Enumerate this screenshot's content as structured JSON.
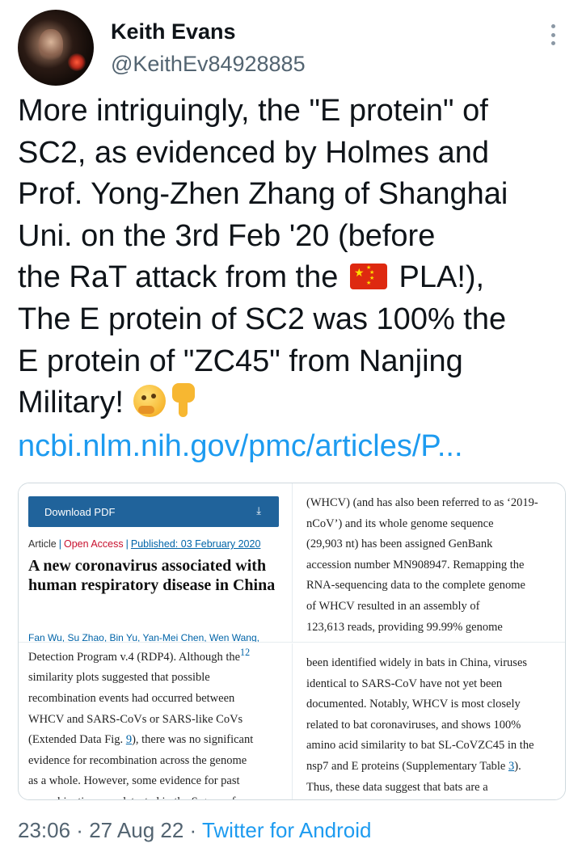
{
  "author": {
    "name": "Keith Evans",
    "handle": "@KeithEv84928885"
  },
  "tweet": {
    "lines": [
      "More intriguingly, the \"E protein\" of",
      "SC2, as evidenced by Holmes and",
      "Prof. Yong-Zhen Zhang of Shanghai",
      "Uni. on the 3rd Feb '20  (before"
    ],
    "line5_before_flag": "the RaT attack from the ",
    "line5_after_flag": " PLA!),",
    "line6": "The E protein of SC2 was 100% the",
    "line7": "E protein of \"ZC45\" from Nanjing",
    "line8": "Military!",
    "link": "ncbi.nlm.nih.gov/pmc/articles/P..."
  },
  "media": {
    "panel1": {
      "download_label": "Download PDF",
      "download_icon": "download-arrow-icon",
      "meta_type": "Article",
      "meta_access": "Open Access",
      "meta_published": "Published: 03 February 2020",
      "title": "A new coronavirus associated with human respiratory disease in China",
      "authors": [
        "Fan Wu",
        "Su Zhao",
        "Bin Yu",
        "Yan-Mei Chen",
        "Wen Wang,"
      ]
    },
    "panel2": {
      "lines": [
        "(WHCV) (and has also been referred to as ‘2019-",
        "nCoV’) and its whole genome sequence",
        "(29,903 nt) has been assigned GenBank",
        "accession number MN908947. Remapping the",
        "RNA-sequencing data to the complete genome",
        "of WHCV resulted in an assembly of",
        "123,613 reads, providing 99.99% genome"
      ]
    },
    "panel3": {
      "line1": "Detection Program v.4 (RDP4). Although the",
      "line1_ref": "12",
      "lines": [
        "similarity plots suggested that possible",
        "recombination events had occurred between",
        "WHCV and SARS-CoVs or SARS-like CoVs"
      ],
      "line5_prefix": "(Extended Data Fig. ",
      "line5_ref": "9",
      "line5_suffix": "), there was no significant",
      "lines_after": [
        "evidence for recombination across the genome",
        "as a whole. However, some evidence for past",
        "recombination was detected in the S gene of"
      ]
    },
    "panel4": {
      "lines": [
        "been identified widely in bats in China, viruses",
        "identical to SARS-CoV have not yet been",
        "documented. Notably, WHCV is most closely",
        "related to bat coronaviruses, and shows 100%",
        "amino acid similarity to bat SL-CoVZC45 in the"
      ],
      "line6_prefix": "nsp7 and E proteins (Supplementary Table ",
      "line6_ref": "3",
      "line6_suffix": ").",
      "line7": "Thus, these data suggest that bats are a"
    }
  },
  "footer": {
    "time": "23:06",
    "date": "27 Aug 22",
    "separator": " · ",
    "source": "Twitter for Android"
  },
  "colors": {
    "link": "#1d9bf0",
    "secondary": "#536471",
    "pdf_button": "#20639b",
    "open_access": "#c8102e"
  }
}
